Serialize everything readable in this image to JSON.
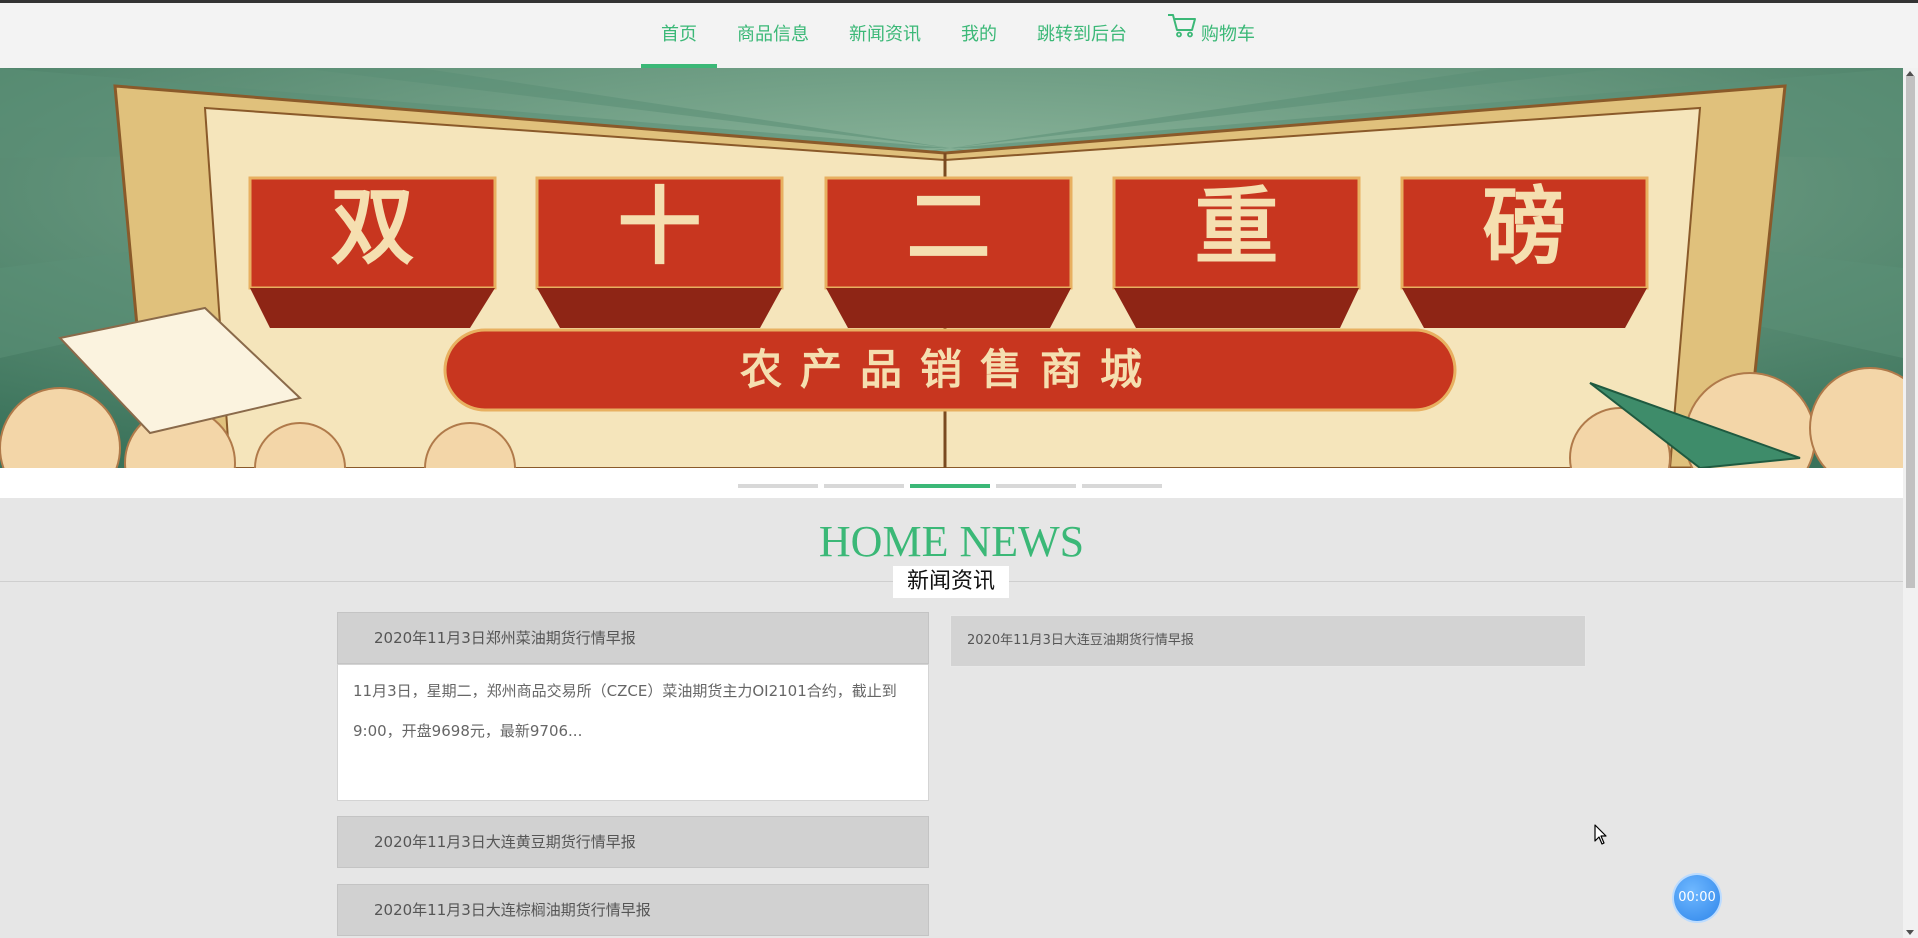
{
  "nav": {
    "items": [
      {
        "label": "首页",
        "active": true
      },
      {
        "label": "商品信息",
        "active": false
      },
      {
        "label": "新闻资讯",
        "active": false
      },
      {
        "label": "我的",
        "active": false
      },
      {
        "label": "跳转到后台",
        "active": false
      }
    ],
    "cart_label": "购物车",
    "cart_icon": "cart-icon"
  },
  "banner": {
    "headline_chars": [
      "双",
      "十",
      "二",
      "重",
      "磅"
    ],
    "subtitle": "农产品销售商城",
    "slide_count": 5,
    "active_slide": 3
  },
  "section": {
    "title": "HOME NEWS",
    "subtitle": "新闻资讯"
  },
  "news": {
    "left": [
      {
        "title": "2020年11月3日郑州菜油期货行情早报",
        "summary": "11月3日，星期二，郑州商品交易所（CZCE）菜油期货主力OI2101合约，截止到9:00，开盘9698元，最新9706..."
      },
      {
        "title": "2020年11月3日大连黄豆期货行情早报"
      },
      {
        "title": "2020年11月3日大连棕榈油期货行情早报"
      }
    ],
    "right": [
      {
        "title": "2020年11月3日大连豆油期货行情早报"
      }
    ]
  },
  "timer": {
    "text": "00:00"
  },
  "colors": {
    "accent": "#3bb877",
    "banner_red": "#c8361f",
    "banner_cream": "#f5dfb0",
    "banner_green": "#3f7a62"
  }
}
